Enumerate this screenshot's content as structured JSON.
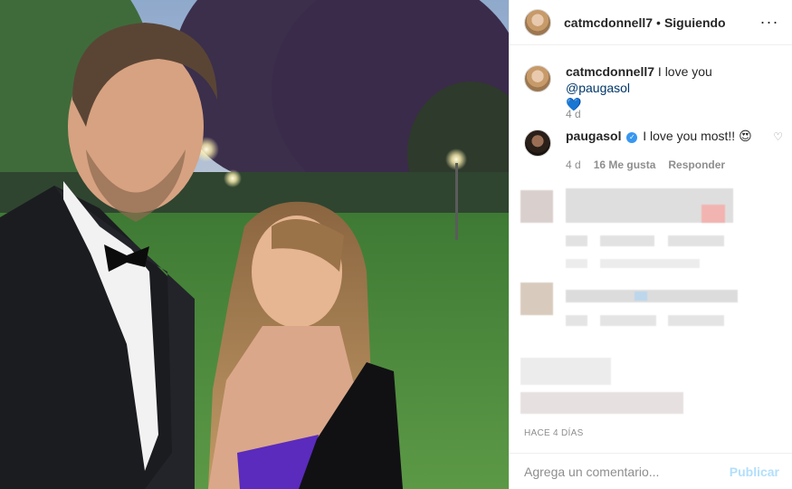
{
  "photo": {
    "description_icon": "photo-icon"
  },
  "header": {
    "username": "catmcdonnell7",
    "separator": "•",
    "follow_status": "Siguiendo",
    "more_icon": "···"
  },
  "caption": {
    "username": "catmcdonnell7",
    "text": "I love you",
    "mention": "@paugasol",
    "emoji": "💙",
    "time": "4 d"
  },
  "reply": {
    "username": "paugasol",
    "verified_icon": "✓",
    "text": "I love you most!!",
    "emoji": "😍",
    "time": "4 d",
    "likes": "16 Me gusta",
    "reply_label": "Responder",
    "like_icon": "♡"
  },
  "timestamp": "HACE 4 DÍAS",
  "add_comment": {
    "placeholder": "Agrega un comentario...",
    "publish_label": "Publicar"
  },
  "colors": {
    "link_blue": "#00376b",
    "publish_disabled": "#b2dffc",
    "verified": "#3897f0",
    "muted": "#8e8e8e"
  }
}
